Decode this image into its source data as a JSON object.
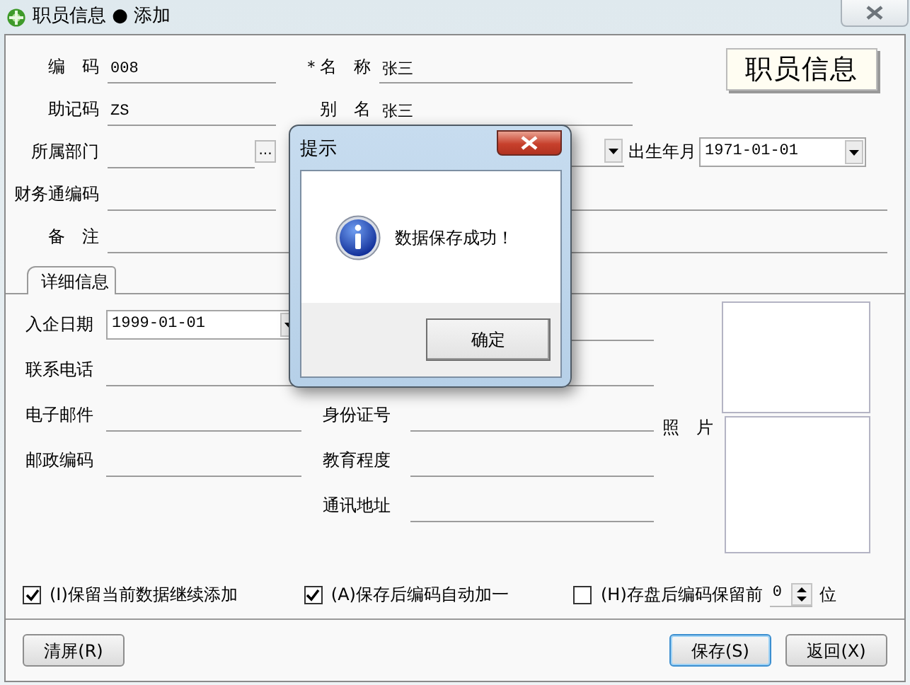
{
  "window": {
    "title": "职员信息 ● 添加"
  },
  "logo": {
    "text": "职员信息"
  },
  "header_rows": [
    [
      {
        "label": "编　码",
        "kind": "text",
        "value": "008"
      },
      {
        "label": "＊名　称",
        "kind": "text",
        "value": "张三"
      }
    ],
    [
      {
        "label": "助记码",
        "kind": "text",
        "value": "ZS"
      },
      {
        "label": "别　名",
        "kind": "text",
        "value": "张三"
      }
    ],
    [
      {
        "label": "所属部门",
        "kind": "browse",
        "button": "..."
      },
      {
        "kind": "dropdown"
      },
      {
        "label": "出生年月",
        "kind": "dropdown",
        "value": "1971-01-01"
      }
    ],
    [
      {
        "label": "财务通编码",
        "kind": "text"
      },
      {
        "kind": "text"
      }
    ],
    [
      {
        "label": "备　注",
        "kind": "text"
      }
    ]
  ],
  "tabs": [
    {
      "label": "详细信息",
      "selected": true
    }
  ],
  "detail_rows": [
    {
      "left": {
        "label": "入企日期",
        "kind": "dropdown",
        "value": "1999-01-01"
      },
      "right": {
        "kind": "text"
      }
    },
    {
      "left": {
        "label": "联系电话",
        "kind": "text"
      },
      "right": {
        "kind": "text"
      }
    },
    {
      "left": {
        "label": "电子邮件",
        "kind": "text"
      },
      "right": {
        "label": "身份证号",
        "kind": "text"
      }
    },
    {
      "left": {
        "label": "邮政编码",
        "kind": "text"
      },
      "right": {
        "label": "教育程度",
        "kind": "text"
      }
    },
    {
      "right": {
        "label": "通讯地址",
        "kind": "text"
      }
    }
  ],
  "photo": {
    "label": "照　片"
  },
  "options": [
    {
      "label": "(I)保留当前数据继续添加",
      "checked": true
    },
    {
      "label": "(A)保存后编码自动加一",
      "checked": true
    },
    {
      "label": "(H)存盘后编码保留前",
      "checked": false,
      "spinner": "0",
      "suffix": "位"
    }
  ],
  "buttons": [
    {
      "label": "清屏(R)",
      "focused": false
    },
    {
      "label": "保存(S)",
      "focused": true
    },
    {
      "label": "返回(X)",
      "focused": false
    }
  ],
  "dialog": {
    "title": "提示",
    "message": "数据保存成功！",
    "button": "确定"
  }
}
